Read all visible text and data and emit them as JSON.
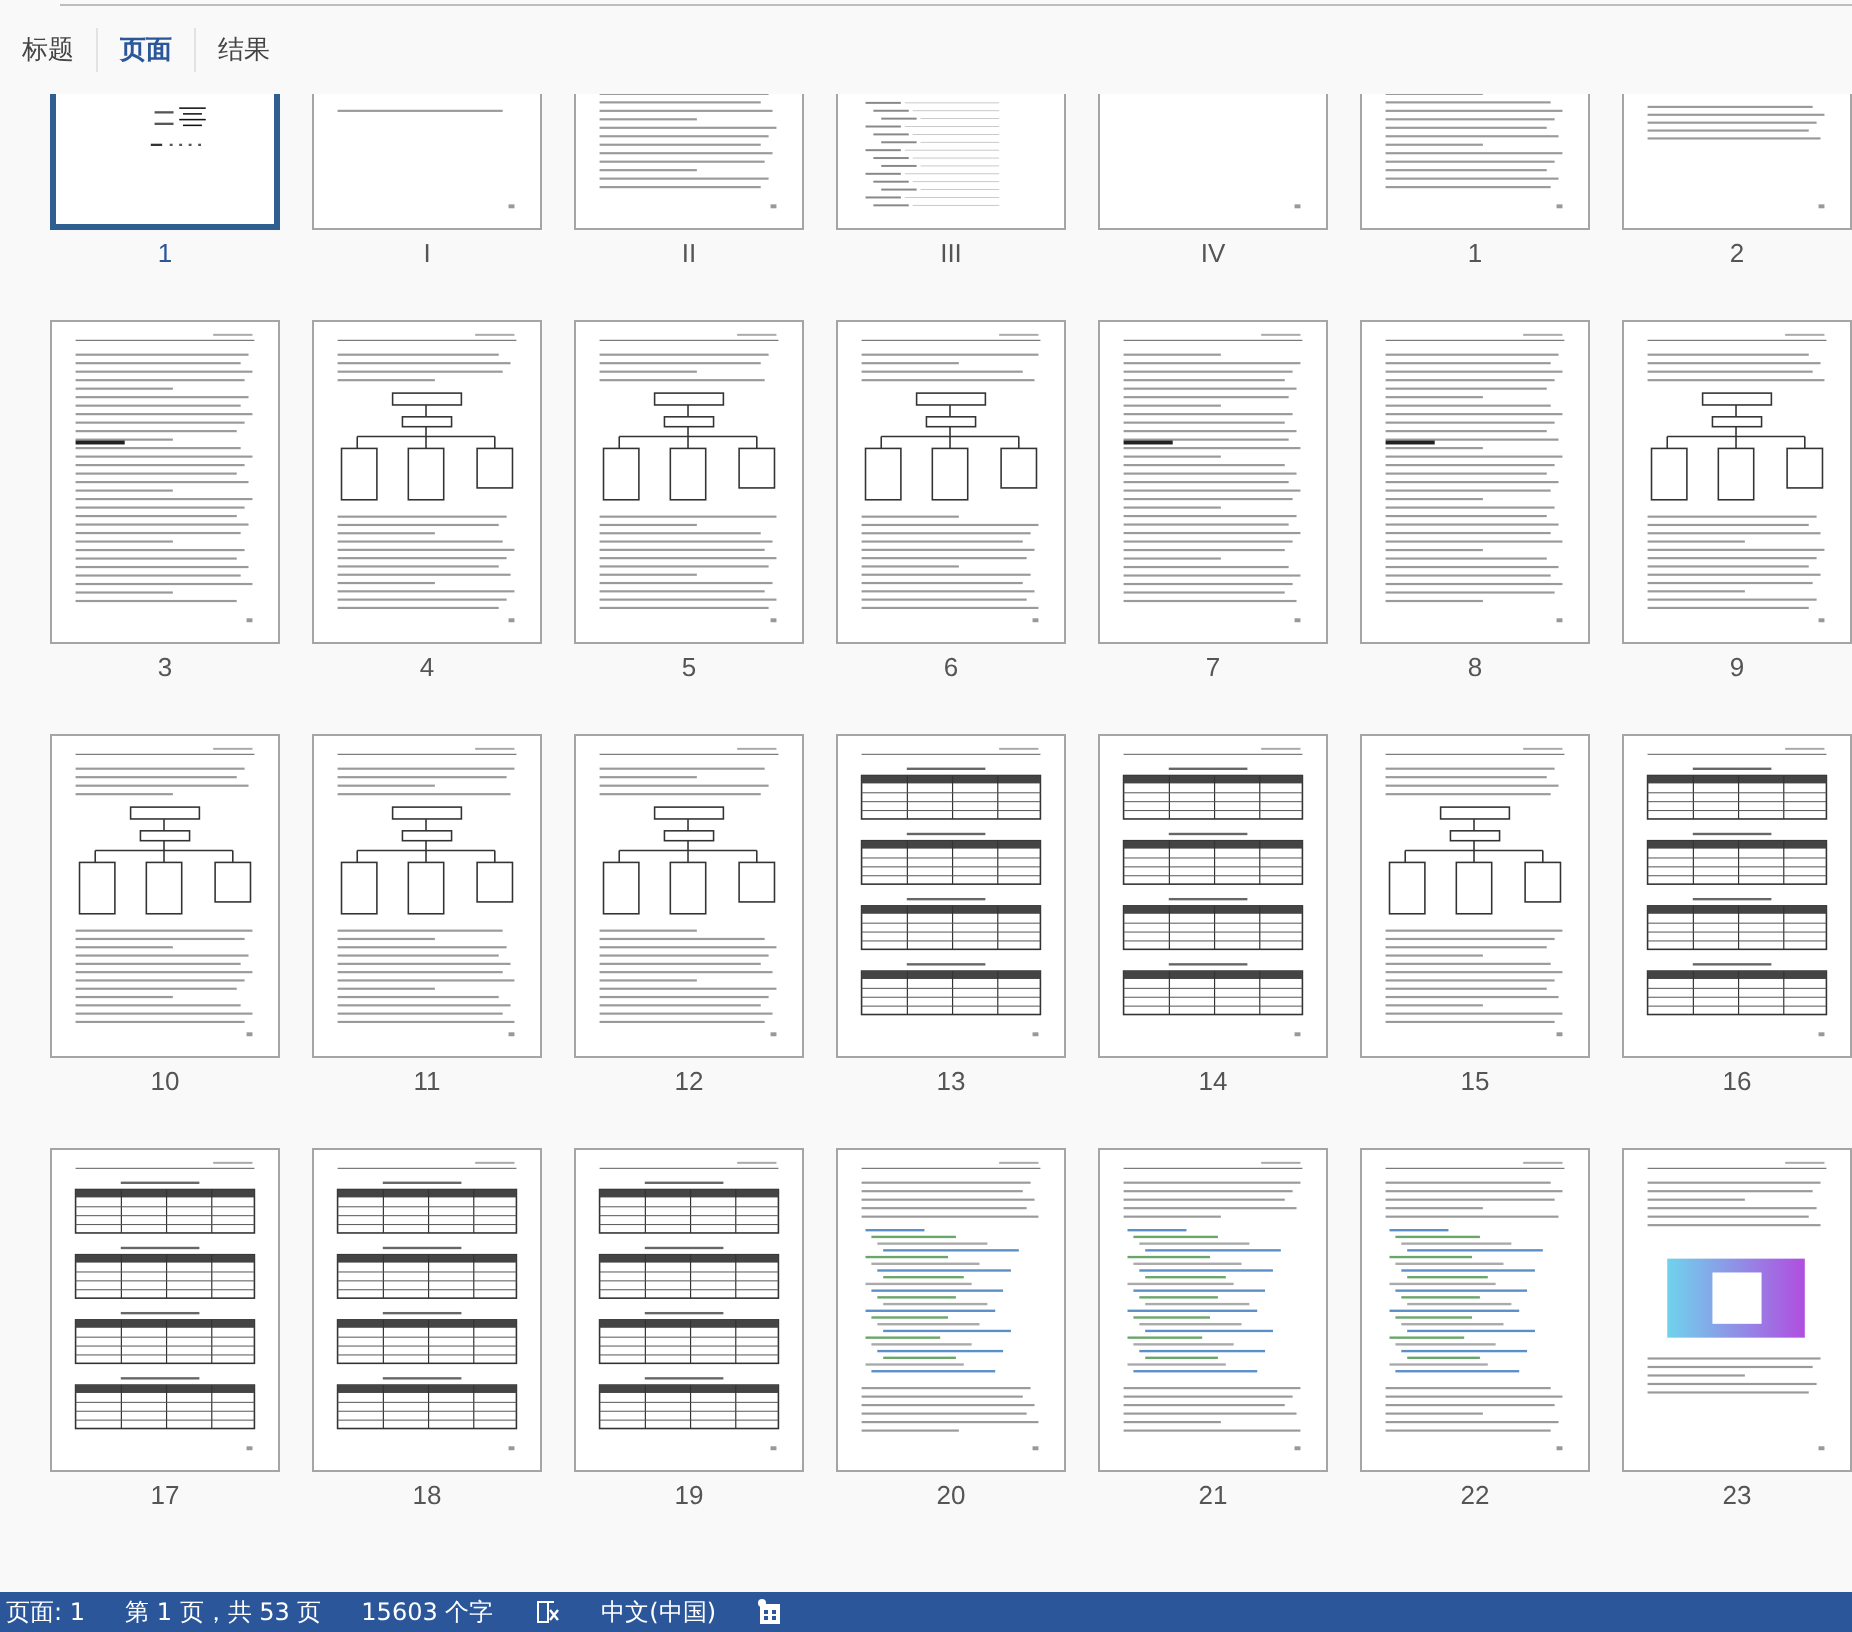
{
  "tabs": [
    {
      "label": "标题",
      "selected": false
    },
    {
      "label": "页面",
      "selected": true
    },
    {
      "label": "结果",
      "selected": false
    }
  ],
  "pages": [
    {
      "label": "1",
      "kind": "title",
      "selected": true
    },
    {
      "label": "I",
      "kind": "short",
      "selected": false
    },
    {
      "label": "II",
      "kind": "text",
      "selected": false
    },
    {
      "label": "III",
      "kind": "toc",
      "selected": false
    },
    {
      "label": "IV",
      "kind": "blank",
      "selected": false
    },
    {
      "label": "1",
      "kind": "text",
      "selected": false
    },
    {
      "label": "2",
      "kind": "short",
      "selected": false
    },
    {
      "label": "3",
      "kind": "text",
      "selected": false
    },
    {
      "label": "4",
      "kind": "diagram",
      "selected": false
    },
    {
      "label": "5",
      "kind": "diagram",
      "selected": false
    },
    {
      "label": "6",
      "kind": "diagram",
      "selected": false
    },
    {
      "label": "7",
      "kind": "text",
      "selected": false
    },
    {
      "label": "8",
      "kind": "text",
      "selected": false
    },
    {
      "label": "9",
      "kind": "diagram",
      "selected": false
    },
    {
      "label": "10",
      "kind": "diagram",
      "selected": false
    },
    {
      "label": "11",
      "kind": "diagram",
      "selected": false
    },
    {
      "label": "12",
      "kind": "diagram",
      "selected": false
    },
    {
      "label": "13",
      "kind": "table",
      "selected": false
    },
    {
      "label": "14",
      "kind": "table",
      "selected": false
    },
    {
      "label": "15",
      "kind": "diagram",
      "selected": false
    },
    {
      "label": "16",
      "kind": "table",
      "selected": false
    },
    {
      "label": "17",
      "kind": "table",
      "selected": false
    },
    {
      "label": "18",
      "kind": "table",
      "selected": false
    },
    {
      "label": "19",
      "kind": "table",
      "selected": false
    },
    {
      "label": "20",
      "kind": "code",
      "selected": false
    },
    {
      "label": "21",
      "kind": "code",
      "selected": false
    },
    {
      "label": "22",
      "kind": "code",
      "selected": false
    },
    {
      "label": "23",
      "kind": "image",
      "selected": false
    }
  ],
  "status_bar": {
    "page": "页面: 1",
    "position": "第 1 页，共 53 页",
    "words": "15603 个字",
    "language": "中文(中国)"
  }
}
